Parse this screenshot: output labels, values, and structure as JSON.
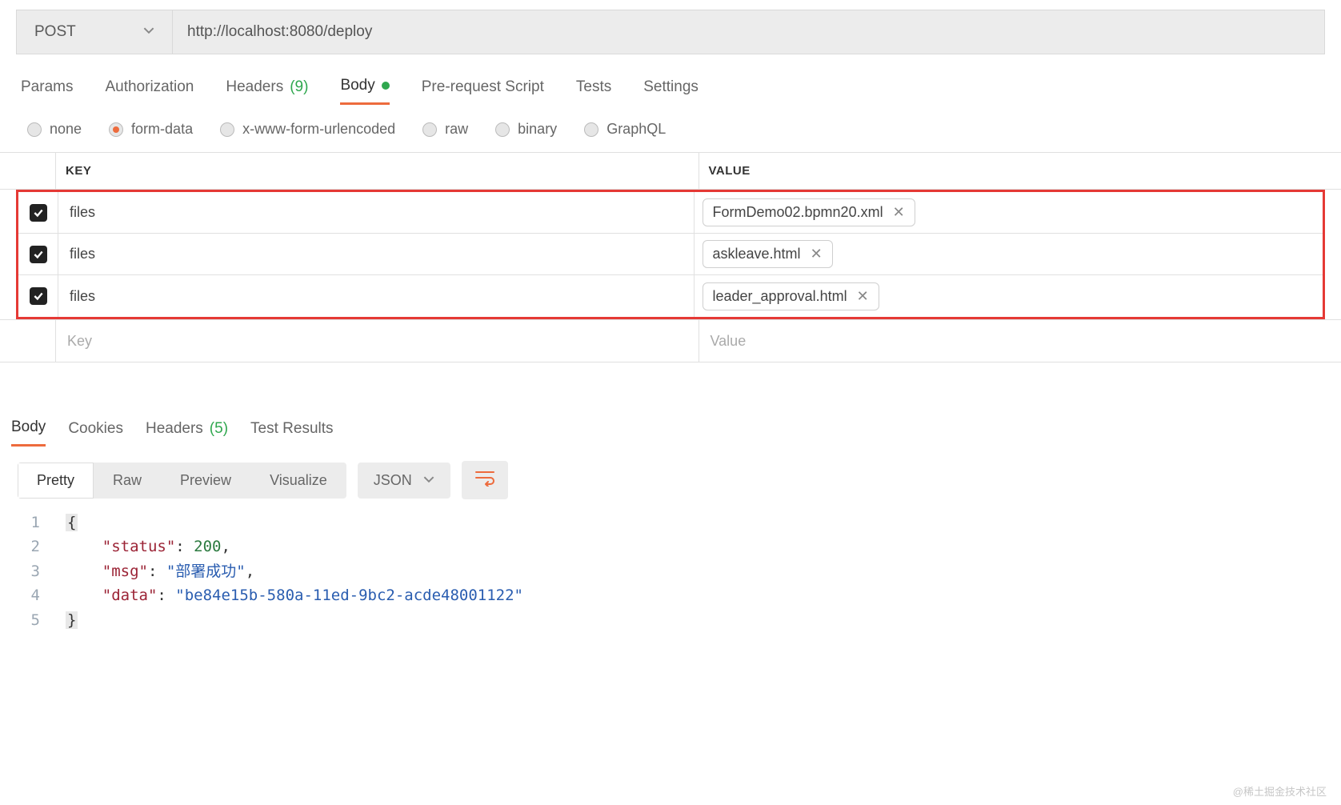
{
  "request": {
    "method": "POST",
    "url": "http://localhost:8080/deploy"
  },
  "tabs": {
    "params": "Params",
    "authorization": "Authorization",
    "headers_label": "Headers",
    "headers_count": "(9)",
    "body": "Body",
    "prerequest": "Pre-request Script",
    "tests": "Tests",
    "settings": "Settings"
  },
  "body_types": {
    "none": "none",
    "form_data": "form-data",
    "xwww": "x-www-form-urlencoded",
    "raw": "raw",
    "binary": "binary",
    "graphql": "GraphQL"
  },
  "kv_header": {
    "key": "KEY",
    "value": "VALUE"
  },
  "kv_rows": [
    {
      "key": "files",
      "file": "FormDemo02.bpmn20.xml"
    },
    {
      "key": "files",
      "file": "askleave.html"
    },
    {
      "key": "files",
      "file": "leader_approval.html"
    }
  ],
  "kv_placeholder": {
    "key": "Key",
    "value": "Value"
  },
  "response_tabs": {
    "body": "Body",
    "cookies": "Cookies",
    "headers_label": "Headers",
    "headers_count": "(5)",
    "test_results": "Test Results"
  },
  "view": {
    "pretty": "Pretty",
    "raw": "Raw",
    "preview": "Preview",
    "visualize": "Visualize",
    "format": "JSON"
  },
  "json_lines": {
    "l1": "{",
    "l2_key": "\"status\"",
    "l2_val": "200",
    "l3_key": "\"msg\"",
    "l3_val": "\"部署成功\"",
    "l4_key": "\"data\"",
    "l4_val": "\"be84e15b-580a-11ed-9bc2-acde48001122\"",
    "l5": "}"
  },
  "line_numbers": {
    "n1": "1",
    "n2": "2",
    "n3": "3",
    "n4": "4",
    "n5": "5"
  },
  "watermark": "@稀土掘金技术社区"
}
